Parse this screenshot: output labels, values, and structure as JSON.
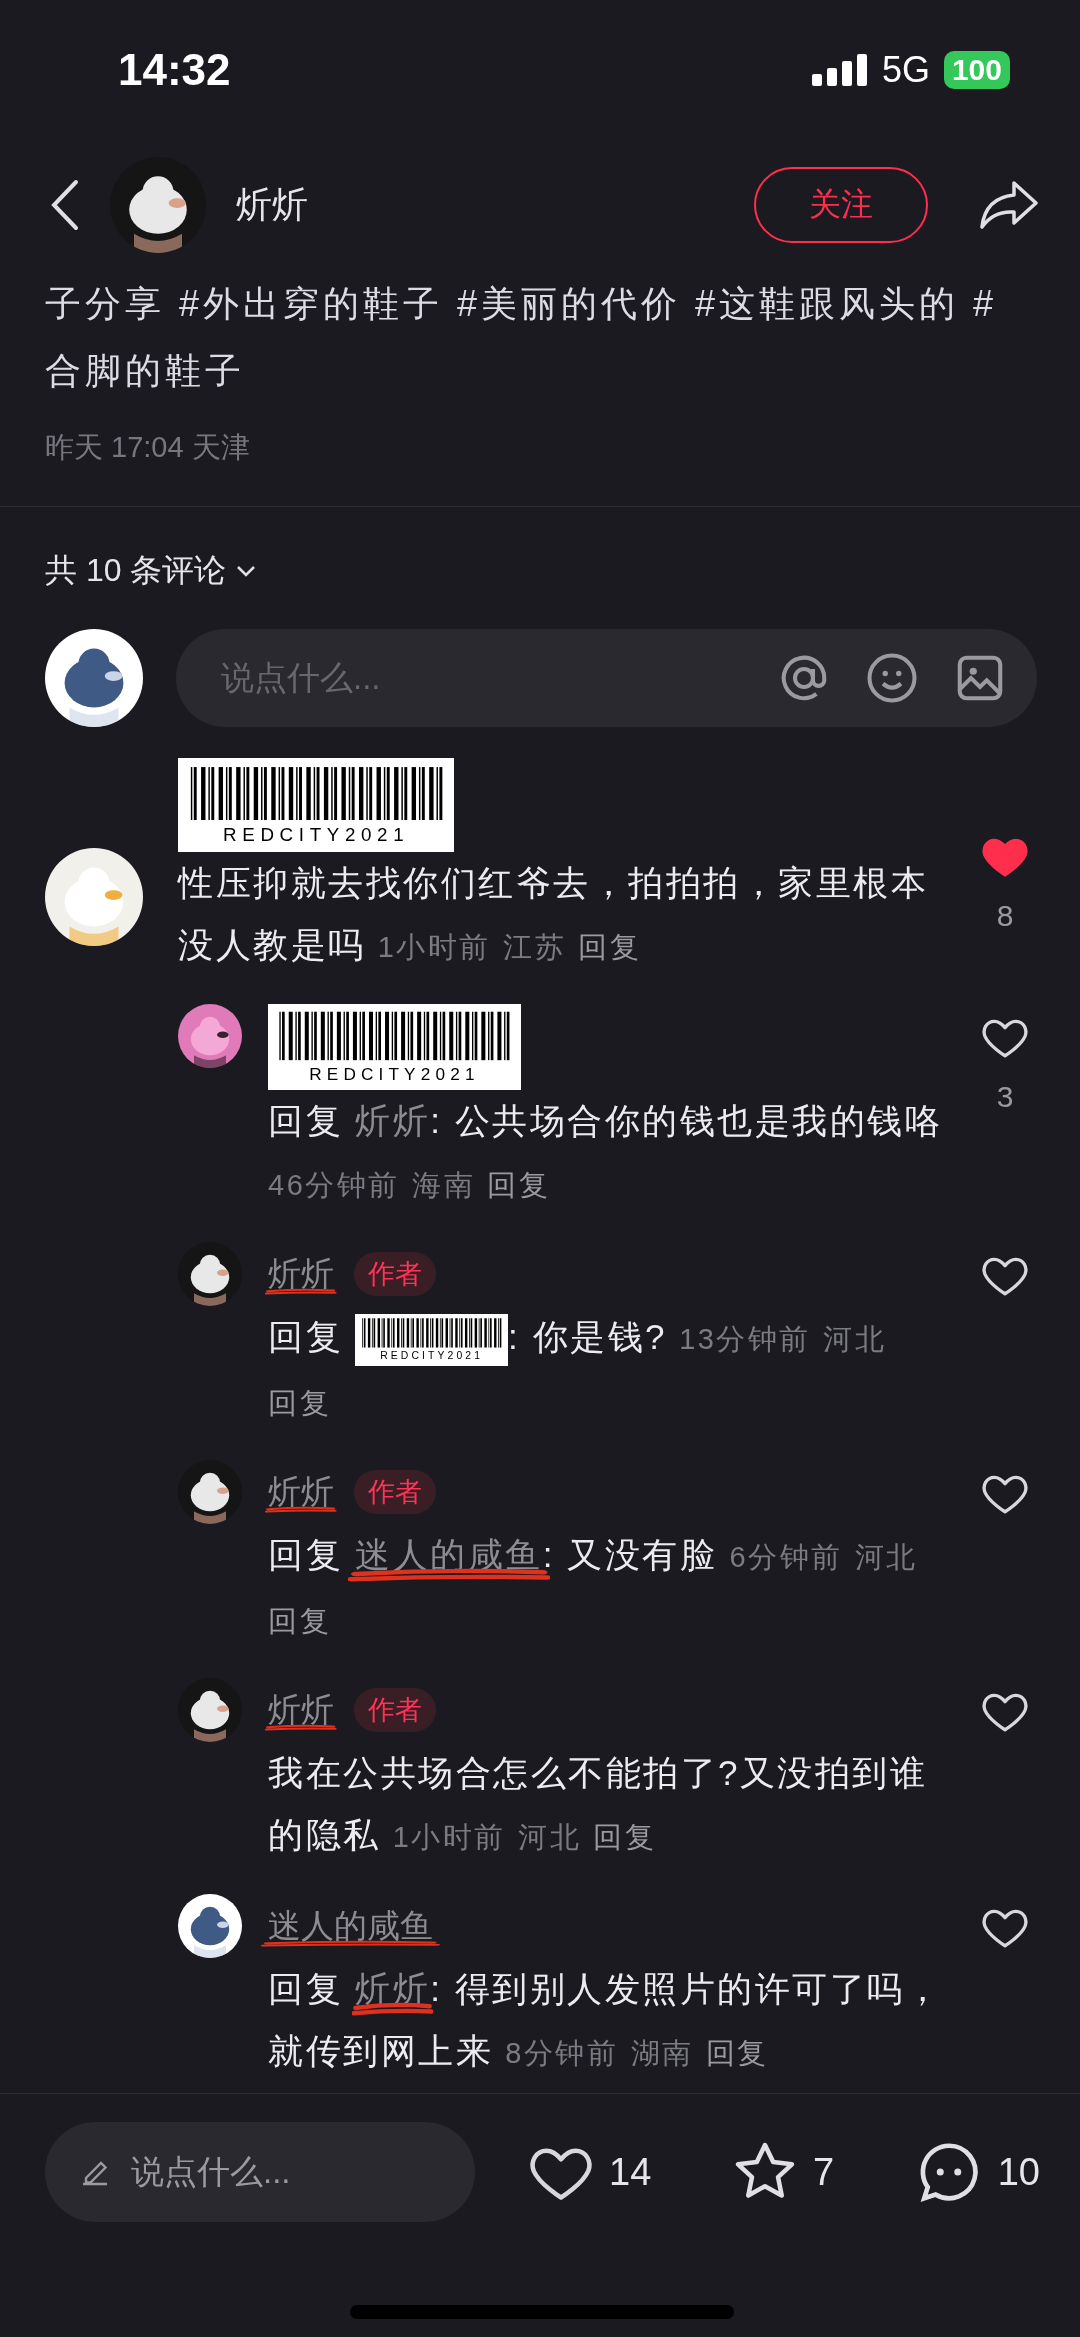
{
  "status_bar": {
    "time": "14:32",
    "network": "5G",
    "battery": "100"
  },
  "header": {
    "author": "炘炘",
    "follow": "关注"
  },
  "post": {
    "caption": "子分享 #外出穿的鞋子 #美丽的代价 #这鞋跟风头的 #合脚的鞋子",
    "date": "昨天 17:04",
    "location": "天津"
  },
  "comments_header": "共 10 条评论",
  "composer": {
    "placeholder": "说点什么..."
  },
  "comments": [
    {
      "sticker": "REDCITY2021",
      "text": "性压抑就去找你们红爷去，拍拍拍，家里根本没人教是吗",
      "time": "1小时前",
      "location": "江苏",
      "reply": "回复",
      "likes": "8",
      "liked": true,
      "children": [
        {
          "sticker": "REDCITY2021",
          "reply_label": "回复",
          "reply_to": {
            "name": "炘炘"
          },
          "text": ": 公共场合你的钱也是我的钱咯",
          "time": "46分钟前",
          "location": "海南",
          "reply": "回复",
          "likes": "3",
          "liked": false
        },
        {
          "name": "炘炘",
          "scribbled": true,
          "badge": "作者",
          "reply_label": "回复",
          "reply_to": {
            "sticker": "REDCITY2021"
          },
          "text": ": 你是钱?",
          "time": "13分钟前",
          "location": "河北",
          "reply": "回复",
          "liked": false
        },
        {
          "name": "炘炘",
          "scribbled": true,
          "badge": "作者",
          "reply_label": "回复",
          "reply_to": {
            "name": "迷人的咸鱼",
            "scribbled": true
          },
          "text": ": 又没有脸",
          "time": "6分钟前",
          "location": "河北",
          "reply": "回复",
          "liked": false
        },
        {
          "name": "炘炘",
          "scribbled": true,
          "badge": "作者",
          "text": "我在公共场合怎么不能拍了?又没拍到谁的隐私",
          "time": "1小时前",
          "location": "河北",
          "reply": "回复",
          "liked": false
        },
        {
          "name": "迷人的咸鱼",
          "scribbled": true,
          "reply_label": "回复",
          "reply_to": {
            "name": "炘炘",
            "scribbled": true
          },
          "text": ": 得到别人发照片的许可了吗，就传到网上来",
          "time": "8分钟前",
          "location": "湖南",
          "reply": "回复",
          "liked": false
        }
      ]
    }
  ],
  "bottom_bar": {
    "placeholder": "说点什么...",
    "likes": "14",
    "collects": "7",
    "comments": "10"
  }
}
